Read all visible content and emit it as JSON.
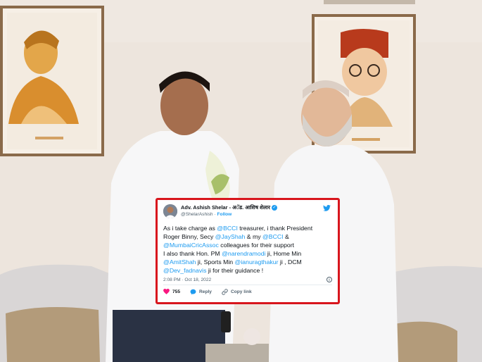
{
  "tweet": {
    "author_name": "Adv. Ashish Shelar - अॅड. आशिष शेलार",
    "handle": "@ShelarAshish",
    "separator": "·",
    "follow_label": "Follow",
    "lines": [
      [
        {
          "t": "As i take charge as ",
          "m": false
        },
        {
          "t": "@BCCI",
          "m": true
        },
        {
          "t": " treasurer, i thank President",
          "m": false
        }
      ],
      [
        {
          "t": "Roger Binny, Secy ",
          "m": false
        },
        {
          "t": "@JayShah",
          "m": true
        },
        {
          "t": " & my ",
          "m": false
        },
        {
          "t": "@BCCI",
          "m": true
        },
        {
          "t": " &",
          "m": false
        }
      ],
      [
        {
          "t": "@MumbaiCricAssoc",
          "m": true
        },
        {
          "t": " colleagues for their support",
          "m": false
        }
      ],
      [
        {
          "t": "I also thank Hon. PM ",
          "m": false
        },
        {
          "t": "@narendramodi",
          "m": true
        },
        {
          "t": " ji, Home Min",
          "m": false
        }
      ],
      [
        {
          "t": "@AmitShah",
          "m": true
        },
        {
          "t": " ji, Sports Min ",
          "m": false
        },
        {
          "t": "@ianuragthakur",
          "m": true
        },
        {
          "t": " ji , DCM",
          "m": false
        }
      ],
      [
        {
          "t": "@Dev_fadnavis",
          "m": true
        },
        {
          "t": " ji for their guidance !",
          "m": false
        }
      ]
    ],
    "timestamp": "2:08 PM · Oct 18, 2022",
    "info_icon": "i",
    "like_count": "755",
    "reply_label": "Reply",
    "copy_link_label": "Copy link",
    "icons": [
      "avatar",
      "verified-badge-icon",
      "twitter-bird-icon",
      "info-icon",
      "heart-icon",
      "reply-icon",
      "link-icon"
    ],
    "colors": {
      "frame": "#d8161d",
      "link": "#1d9bf0",
      "heart": "#f91880"
    }
  }
}
